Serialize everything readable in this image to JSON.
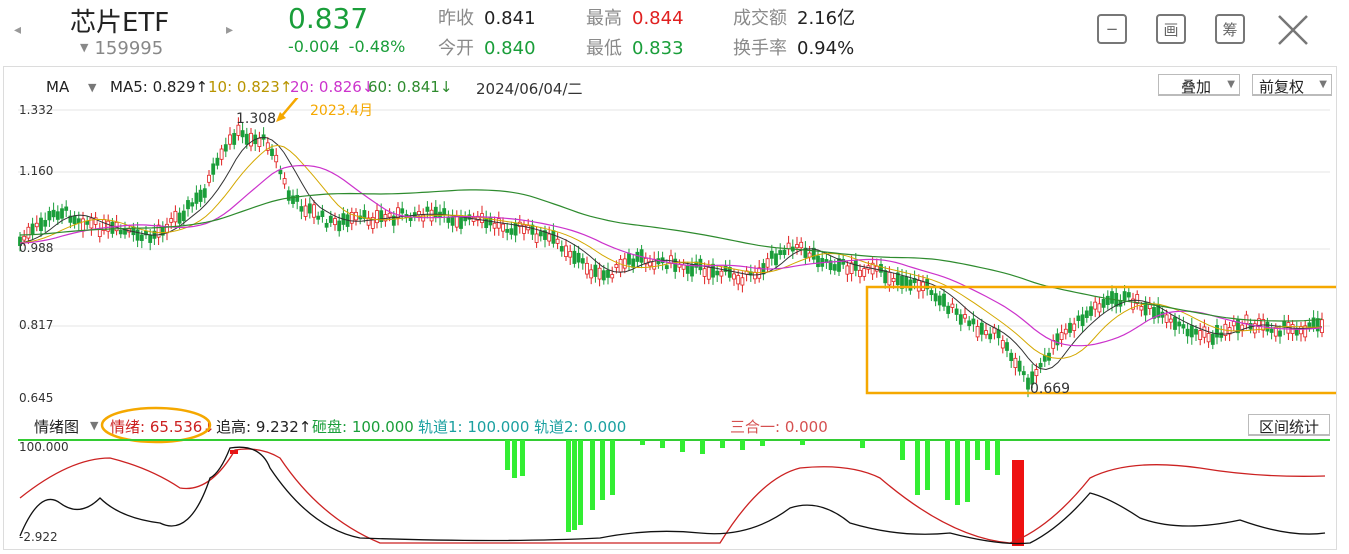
{
  "header": {
    "title": "芯片ETF",
    "code": "159995",
    "price": "0.837",
    "change": "-0.004",
    "change_pct": "-0.48%",
    "stats": {
      "prev_close_label": "昨收",
      "prev_close": "0.841",
      "open_label": "今开",
      "open": "0.840",
      "high_label": "最高",
      "high": "0.844",
      "low_label": "最低",
      "low": "0.833",
      "turnover_label": "成交额",
      "turnover": "2.16亿",
      "turnover_rate_label": "换手率",
      "turnover_rate": "0.94%"
    },
    "buttons": {
      "minimize": "−",
      "chart_mode": "画",
      "calc": "筹"
    },
    "colors": {
      "down": "#1a9e3a",
      "up": "#e02020",
      "gray": "#8a8a8a"
    }
  },
  "ma_bar": {
    "label": "MA",
    "ma5": "MA5: 0.829↑",
    "ma10": "10: 0.823↑",
    "ma20": "20: 0.826↓",
    "ma60": "60: 0.841↓",
    "date": "2024/06/04/二",
    "overlay_label": "叠加",
    "adjust_label": "前复权"
  },
  "main_chart": {
    "y_labels": [
      "1.332",
      "1.160",
      "0.988",
      "0.817",
      "0.645"
    ],
    "high_marker": "1.308",
    "low_marker": "0.669",
    "annotation": "2023.4月",
    "colors": {
      "ma5": "#333333",
      "ma10": "#d4a800",
      "ma20": "#cc33cc",
      "ma60": "#2e8b2e",
      "highlight": "#f5a800"
    }
  },
  "indicator_bar": {
    "name": "情绪图",
    "mood": "情绪: 65.536↓",
    "chase": "追高: 9.232↑",
    "smash": "砸盘: 100.000",
    "track1": "轨道1: 100.000",
    "track2": "轨道2: 0.000",
    "combo": "三合一: 0.000",
    "range_stats": "区间统计"
  },
  "sub_chart": {
    "y_top": "100.000",
    "y_bottom": "-2.922"
  }
}
